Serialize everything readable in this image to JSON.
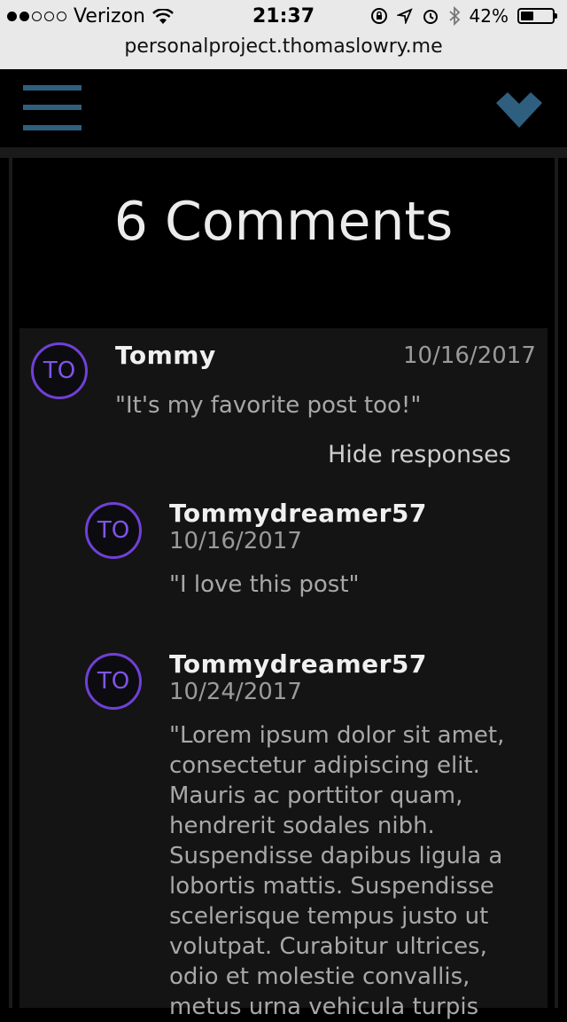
{
  "status_bar": {
    "carrier": "Verizon",
    "time": "21:37",
    "battery_percent": "42%",
    "battery_level": 0.42,
    "icons": [
      "signal-dots-icon",
      "wifi-icon",
      "rotation-lock-icon",
      "location-icon",
      "alarm-icon",
      "bluetooth-icon",
      "battery-icon"
    ]
  },
  "browser": {
    "url": "personalproject.thomaslowry.me"
  },
  "nav": {
    "menu_icon": "hamburger-icon",
    "action_icon": "chevron-down-icon",
    "accent_color": "#2f5f7f"
  },
  "comments": {
    "title": "6 Comments",
    "items": [
      {
        "initials": "TO",
        "author": "Tommy",
        "date": "10/16/2017",
        "text": "\"It's my favorite post too!\"",
        "toggle_label": "Hide responses",
        "responses": [
          {
            "initials": "TO",
            "author": "Tommydreamer57",
            "date": "10/16/2017",
            "text": "\"I love this post\""
          },
          {
            "initials": "TO",
            "author": "Tommydreamer57",
            "date": "10/24/2017",
            "text_lines": [
              "\"Lorem ipsum dolor sit amet,",
              "consectetur adipiscing elit.",
              "Mauris ac porttitor quam,",
              "hendrerit sodales nibh.",
              "Suspendisse dapibus ligula a",
              "lobortis mattis. Suspendisse",
              "scelerisque tempus justo ut",
              "volutpat. Curabitur ultrices,",
              "odio et molestie convallis,",
              "metus urna vehicula turpis"
            ]
          }
        ]
      }
    ],
    "avatar_color": "#7040d6"
  }
}
